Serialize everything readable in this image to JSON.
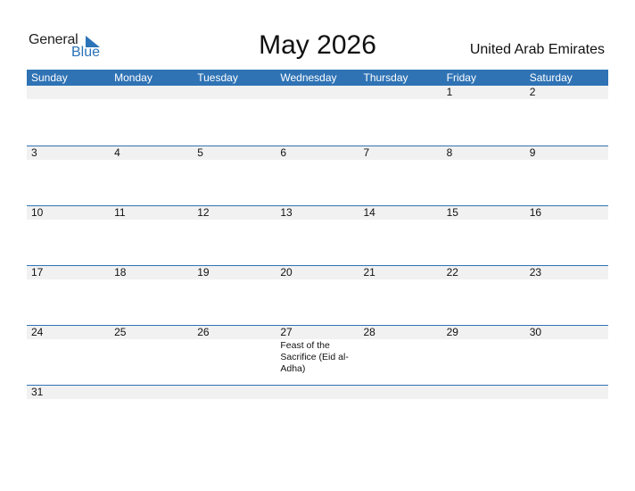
{
  "logo": {
    "line1": "General",
    "line2": "Blue",
    "brand_color": "#2a73b8"
  },
  "title": "May 2026",
  "country": "United Arab Emirates",
  "colors": {
    "header_bg": "#2f73b5",
    "strip_bg": "#f1f1f1"
  },
  "weekdays": [
    "Sunday",
    "Monday",
    "Tuesday",
    "Wednesday",
    "Thursday",
    "Friday",
    "Saturday"
  ],
  "weeks": [
    [
      "",
      "",
      "",
      "",
      "",
      "1",
      "2"
    ],
    [
      "3",
      "4",
      "5",
      "6",
      "7",
      "8",
      "9"
    ],
    [
      "10",
      "11",
      "12",
      "13",
      "14",
      "15",
      "16"
    ],
    [
      "17",
      "18",
      "19",
      "20",
      "21",
      "22",
      "23"
    ],
    [
      "24",
      "25",
      "26",
      "27",
      "28",
      "29",
      "30"
    ],
    [
      "31",
      "",
      "",
      "",
      "",
      "",
      ""
    ]
  ],
  "holidays": [
    {
      "week": 4,
      "day": 3,
      "label": "Feast of the Sacrifice (Eid al-Adha)"
    }
  ]
}
